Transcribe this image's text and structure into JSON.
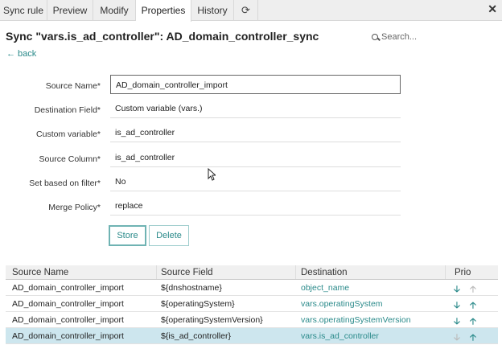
{
  "tabs": [
    "Sync rule",
    "Preview",
    "Modify",
    "Properties",
    "History"
  ],
  "active_tab": "Properties",
  "icons": {
    "refresh": "refresh-icon",
    "close": "close-icon",
    "search": "search-icon",
    "back": "back-arrow-icon"
  },
  "header": {
    "title": "Sync \"vars.is_ad_controller\": AD_domain_controller_sync",
    "search_placeholder": "Search..."
  },
  "back_label": "back",
  "form": {
    "source_name": {
      "label": "Source Name*",
      "value": "AD_domain_controller_import"
    },
    "destination_field": {
      "label": "Destination Field*",
      "value": "Custom variable (vars.)"
    },
    "custom_variable": {
      "label": "Custom variable*",
      "value": "is_ad_controller"
    },
    "source_column": {
      "label": "Source Column*",
      "value": "is_ad_controller"
    },
    "set_based_on_filter": {
      "label": "Set based on filter*",
      "value": "No"
    },
    "merge_policy": {
      "label": "Merge Policy*",
      "value": "replace"
    }
  },
  "buttons": {
    "store": "Store",
    "delete": "Delete"
  },
  "table": {
    "headers": [
      "Source Name",
      "Source Field",
      "Destination",
      "Prio"
    ],
    "rows": [
      {
        "source_name": "AD_domain_controller_import",
        "source_field": "${dnshostname}",
        "destination": "object_name",
        "selected": false
      },
      {
        "source_name": "AD_domain_controller_import",
        "source_field": "${operatingSystem}",
        "destination": "vars.operatingSystem",
        "selected": false
      },
      {
        "source_name": "AD_domain_controller_import",
        "source_field": "${operatingSystemVersion}",
        "destination": "vars.operatingSystemVersion",
        "selected": false
      },
      {
        "source_name": "AD_domain_controller_import",
        "source_field": "${is_ad_controller}",
        "destination": "vars.is_ad_controller",
        "selected": true
      }
    ]
  },
  "colors": {
    "accent": "#2a8a8a",
    "selected_row": "#cde6ee"
  }
}
